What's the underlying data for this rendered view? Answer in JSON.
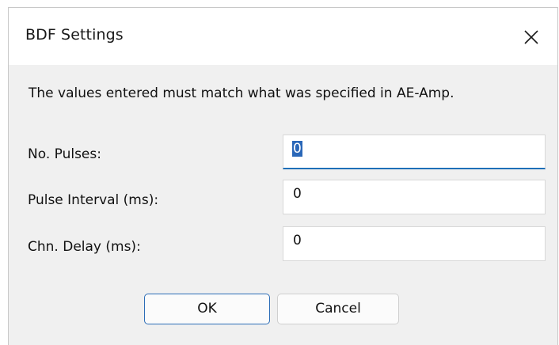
{
  "dialog": {
    "title": "BDF Settings",
    "message": "The values entered must match what was specified in AE-Amp."
  },
  "fields": {
    "pulses": {
      "label": "No. Pulses:",
      "value": "0"
    },
    "interval": {
      "label": "Pulse Interval (ms):",
      "value": "0"
    },
    "delay": {
      "label": "Chn. Delay (ms):",
      "value": "0"
    }
  },
  "buttons": {
    "ok": "OK",
    "cancel": "Cancel"
  },
  "icons": {
    "close": "close-icon"
  },
  "colors": {
    "accent": "#2c6db7",
    "dialog_bg": "#f0f0f0"
  }
}
